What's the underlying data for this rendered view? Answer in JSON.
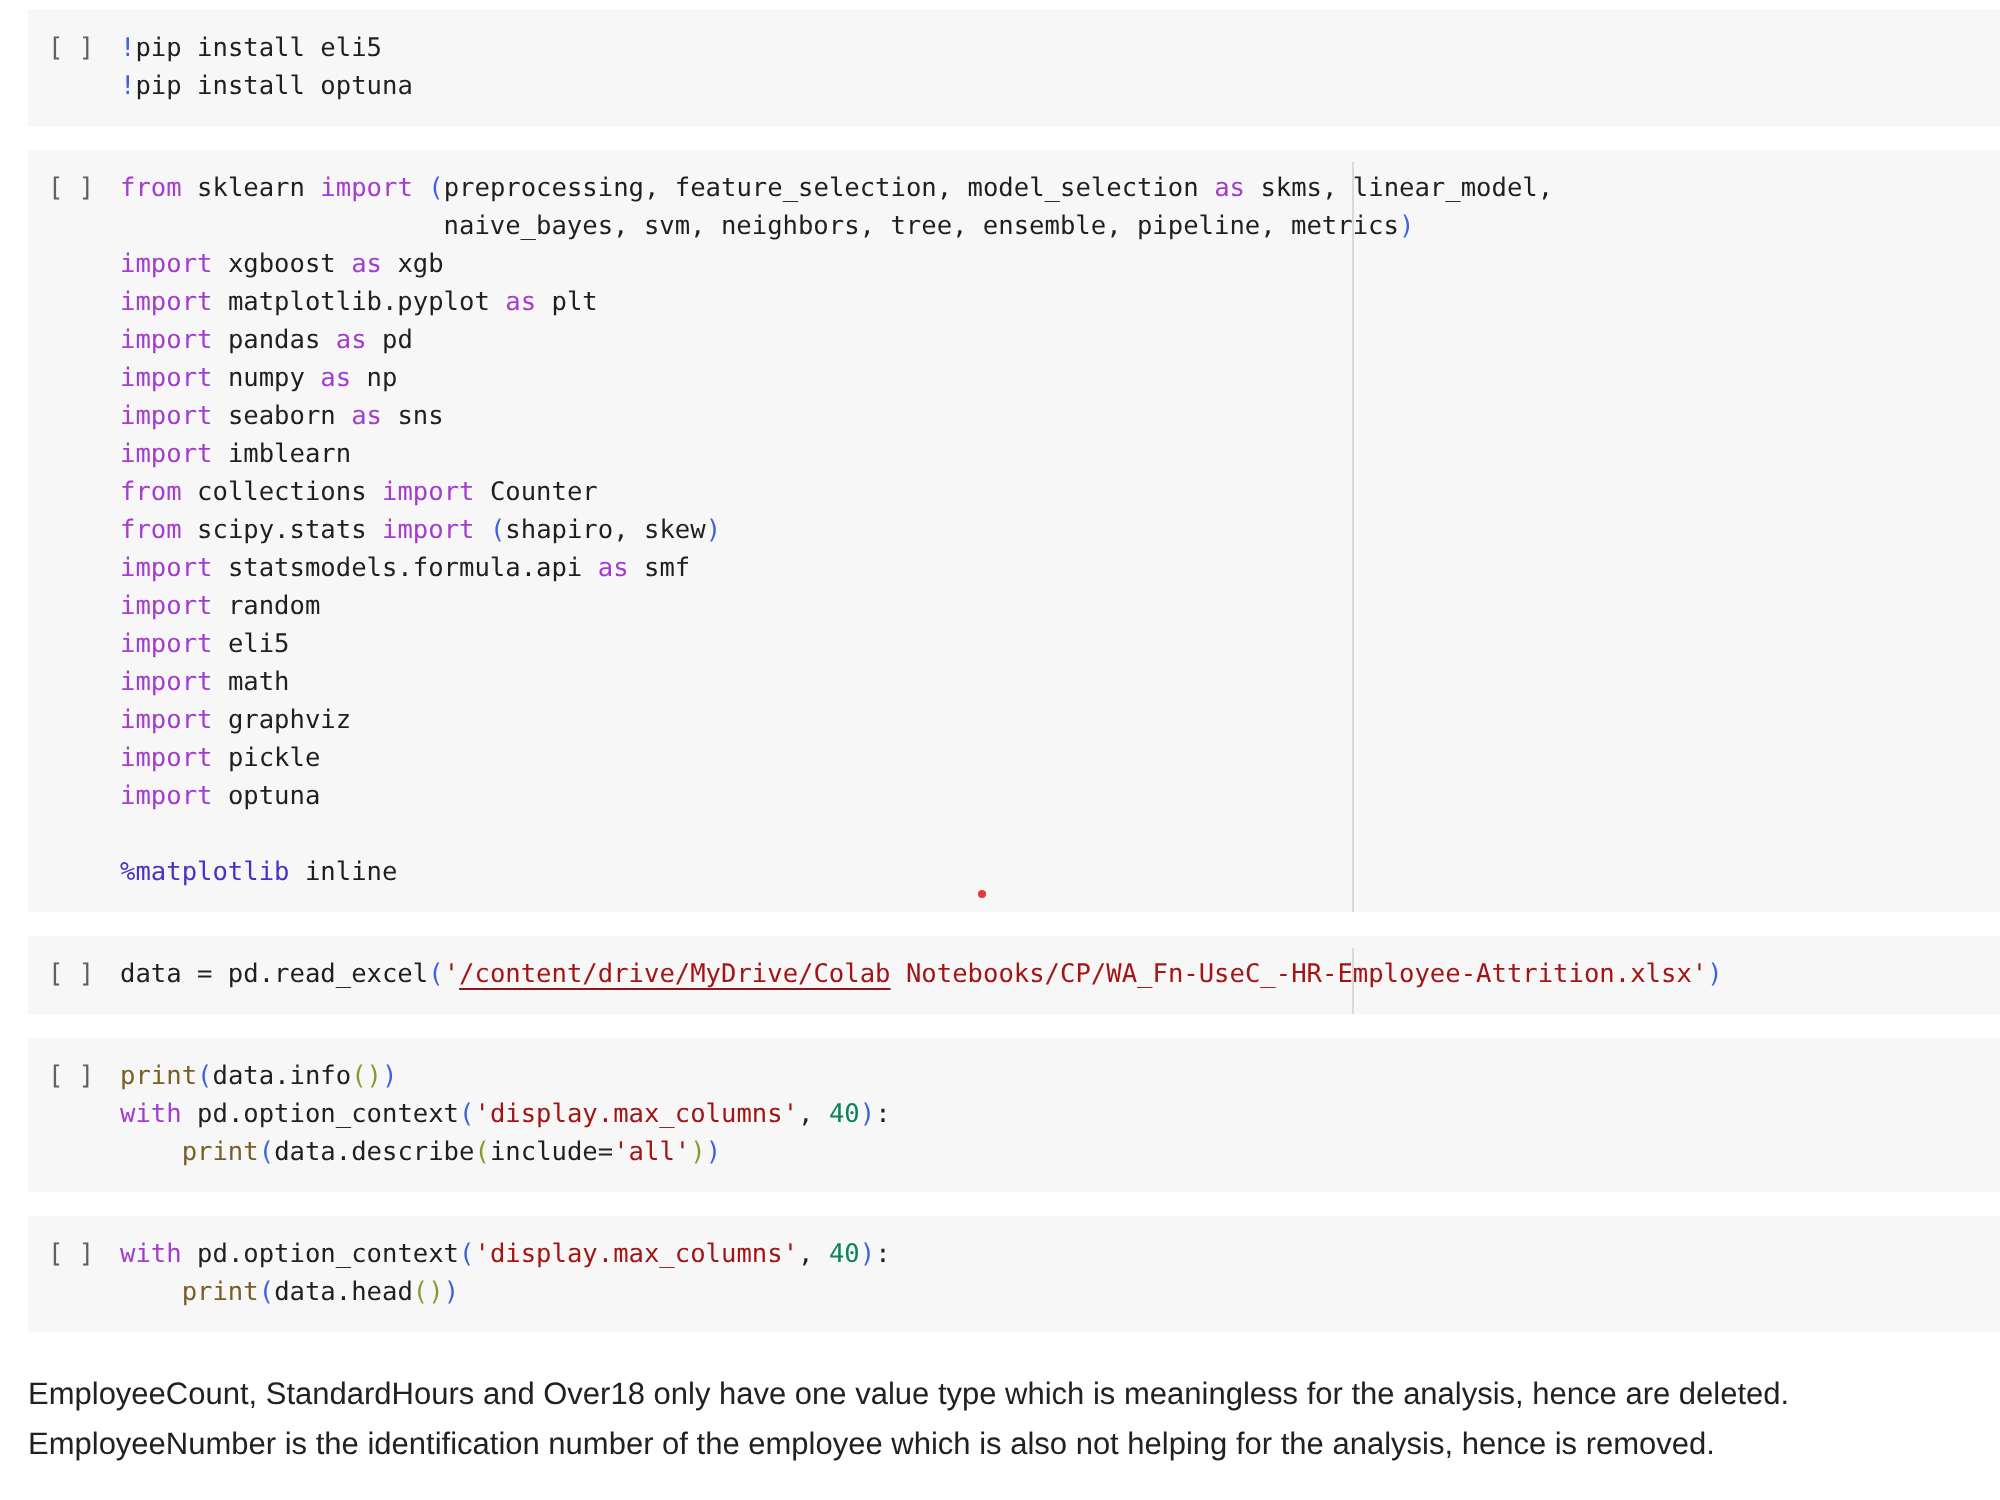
{
  "cells": [
    {
      "prompt": "[ ]",
      "ruler": false,
      "lines": [
        {
          "kind": "code",
          "tokens": [
            {
              "kind": "bang",
              "text": "!"
            },
            {
              "kind": "plain",
              "text": "pip install eli5"
            }
          ]
        },
        {
          "kind": "code",
          "tokens": [
            {
              "kind": "bang",
              "text": "!"
            },
            {
              "kind": "plain",
              "text": "pip install optuna"
            }
          ]
        }
      ]
    },
    {
      "prompt": "[ ]",
      "ruler": true,
      "cursor_dot": true,
      "lines": [
        {
          "kind": "code",
          "tokens": [
            {
              "kind": "keyword",
              "text": "from"
            },
            {
              "kind": "plain",
              "text": " sklearn "
            },
            {
              "kind": "keyword",
              "text": "import "
            },
            {
              "kind": "bracket",
              "text": "("
            },
            {
              "kind": "plain",
              "text": "preprocessing, feature_selection, model_selection "
            },
            {
              "kind": "keyword",
              "text": "as"
            },
            {
              "kind": "plain",
              "text": " skms, linear_model,"
            }
          ]
        },
        {
          "kind": "continuation",
          "tokens": [
            {
              "kind": "plain",
              "text": "naive_bayes, svm, neighbors, tree, ensemble, pipeline, metrics"
            },
            {
              "kind": "bracket",
              "text": ")"
            }
          ]
        },
        {
          "kind": "code",
          "tokens": [
            {
              "kind": "keyword",
              "text": "import"
            },
            {
              "kind": "plain",
              "text": " xgboost "
            },
            {
              "kind": "keyword",
              "text": "as"
            },
            {
              "kind": "plain",
              "text": " xgb"
            }
          ]
        },
        {
          "kind": "code",
          "tokens": [
            {
              "kind": "keyword",
              "text": "import"
            },
            {
              "kind": "plain",
              "text": " matplotlib.pyplot "
            },
            {
              "kind": "keyword",
              "text": "as"
            },
            {
              "kind": "plain",
              "text": " plt"
            }
          ]
        },
        {
          "kind": "code",
          "tokens": [
            {
              "kind": "keyword",
              "text": "import"
            },
            {
              "kind": "plain",
              "text": " pandas "
            },
            {
              "kind": "keyword",
              "text": "as"
            },
            {
              "kind": "plain",
              "text": " pd"
            }
          ]
        },
        {
          "kind": "code",
          "tokens": [
            {
              "kind": "keyword",
              "text": "import"
            },
            {
              "kind": "plain",
              "text": " numpy "
            },
            {
              "kind": "keyword",
              "text": "as"
            },
            {
              "kind": "plain",
              "text": " np"
            }
          ]
        },
        {
          "kind": "code",
          "tokens": [
            {
              "kind": "keyword",
              "text": "import"
            },
            {
              "kind": "plain",
              "text": " seaborn "
            },
            {
              "kind": "keyword",
              "text": "as"
            },
            {
              "kind": "plain",
              "text": " sns"
            }
          ]
        },
        {
          "kind": "code",
          "tokens": [
            {
              "kind": "keyword",
              "text": "import"
            },
            {
              "kind": "plain",
              "text": " imblearn"
            }
          ]
        },
        {
          "kind": "code",
          "tokens": [
            {
              "kind": "keyword",
              "text": "from"
            },
            {
              "kind": "plain",
              "text": " collections "
            },
            {
              "kind": "keyword",
              "text": "import"
            },
            {
              "kind": "plain",
              "text": " Counter"
            }
          ]
        },
        {
          "kind": "code",
          "tokens": [
            {
              "kind": "keyword",
              "text": "from"
            },
            {
              "kind": "plain",
              "text": " scipy.stats "
            },
            {
              "kind": "keyword",
              "text": "import "
            },
            {
              "kind": "bracket",
              "text": "("
            },
            {
              "kind": "plain",
              "text": "shapiro, skew"
            },
            {
              "kind": "bracket",
              "text": ")"
            }
          ]
        },
        {
          "kind": "code",
          "tokens": [
            {
              "kind": "keyword",
              "text": "import"
            },
            {
              "kind": "plain",
              "text": " statsmodels.formula.api "
            },
            {
              "kind": "keyword",
              "text": "as"
            },
            {
              "kind": "plain",
              "text": " smf"
            }
          ]
        },
        {
          "kind": "code",
          "tokens": [
            {
              "kind": "keyword",
              "text": "import"
            },
            {
              "kind": "plain",
              "text": " random"
            }
          ]
        },
        {
          "kind": "code",
          "tokens": [
            {
              "kind": "keyword",
              "text": "import"
            },
            {
              "kind": "plain",
              "text": " eli5"
            }
          ]
        },
        {
          "kind": "code",
          "tokens": [
            {
              "kind": "keyword",
              "text": "import"
            },
            {
              "kind": "plain",
              "text": " math"
            }
          ]
        },
        {
          "kind": "code",
          "tokens": [
            {
              "kind": "keyword",
              "text": "import"
            },
            {
              "kind": "plain",
              "text": " graphviz"
            }
          ]
        },
        {
          "kind": "code",
          "tokens": [
            {
              "kind": "keyword",
              "text": "import"
            },
            {
              "kind": "plain",
              "text": " pickle"
            }
          ]
        },
        {
          "kind": "code",
          "tokens": [
            {
              "kind": "keyword",
              "text": "import"
            },
            {
              "kind": "plain",
              "text": " optuna"
            }
          ]
        },
        {
          "kind": "blank"
        },
        {
          "kind": "code",
          "tokens": [
            {
              "kind": "magic",
              "text": "%matplotlib"
            },
            {
              "kind": "plain",
              "text": " inline"
            }
          ]
        }
      ]
    },
    {
      "prompt": "[ ]",
      "ruler": true,
      "lines": [
        {
          "kind": "code",
          "tokens": [
            {
              "kind": "plain",
              "text": "data = pd.read_excel"
            },
            {
              "kind": "bracket",
              "text": "("
            },
            {
              "kind": "string",
              "text": "'"
            },
            {
              "kind": "link",
              "text": "/content/drive/MyDrive/Colab"
            },
            {
              "kind": "string",
              "text": " Notebooks/CP/WA_Fn-UseC_-HR-Employee-Attrition.xlsx'"
            },
            {
              "kind": "bracket",
              "text": ")"
            }
          ]
        }
      ]
    },
    {
      "prompt": "[ ]",
      "ruler": false,
      "lines": [
        {
          "kind": "code",
          "tokens": [
            {
              "kind": "function",
              "text": "print"
            },
            {
              "kind": "bracket",
              "text": "("
            },
            {
              "kind": "plain",
              "text": "data.info"
            },
            {
              "kind": "bracket2",
              "text": "()"
            },
            {
              "kind": "bracket",
              "text": ")"
            }
          ]
        },
        {
          "kind": "code",
          "tokens": [
            {
              "kind": "keyword",
              "text": "with"
            },
            {
              "kind": "plain",
              "text": " pd.option_context"
            },
            {
              "kind": "bracket",
              "text": "("
            },
            {
              "kind": "string",
              "text": "'display.max_columns'"
            },
            {
              "kind": "plain",
              "text": ", "
            },
            {
              "kind": "number",
              "text": "40"
            },
            {
              "kind": "bracket",
              "text": ")"
            },
            {
              "kind": "plain",
              "text": ":"
            }
          ]
        },
        {
          "kind": "indented",
          "tokens": [
            {
              "kind": "function",
              "text": "print"
            },
            {
              "kind": "bracket",
              "text": "("
            },
            {
              "kind": "plain",
              "text": "data.describe"
            },
            {
              "kind": "bracket2",
              "text": "("
            },
            {
              "kind": "plain",
              "text": "include="
            },
            {
              "kind": "string",
              "text": "'all'"
            },
            {
              "kind": "bracket2",
              "text": ")"
            },
            {
              "kind": "bracket",
              "text": ")"
            }
          ]
        }
      ]
    },
    {
      "prompt": "[ ]",
      "ruler": false,
      "lines": [
        {
          "kind": "code",
          "tokens": [
            {
              "kind": "keyword",
              "text": "with"
            },
            {
              "kind": "plain",
              "text": " pd.option_context"
            },
            {
              "kind": "bracket",
              "text": "("
            },
            {
              "kind": "string",
              "text": "'display.max_columns'"
            },
            {
              "kind": "plain",
              "text": ", "
            },
            {
              "kind": "number",
              "text": "40"
            },
            {
              "kind": "bracket",
              "text": ")"
            },
            {
              "kind": "plain",
              "text": ":"
            }
          ]
        },
        {
          "kind": "indented",
          "tokens": [
            {
              "kind": "function",
              "text": "print"
            },
            {
              "kind": "bracket",
              "text": "("
            },
            {
              "kind": "plain",
              "text": "data.head"
            },
            {
              "kind": "bracket2",
              "text": "()"
            },
            {
              "kind": "bracket",
              "text": ")"
            }
          ]
        }
      ]
    }
  ],
  "text_cell": {
    "paragraphs": [
      "EmployeeCount, StandardHours and Over18 only have one value type which is meaningless for the analysis, hence are deleted.",
      "EmployeeNumber is the identification number of the employee which is also not helping for the analysis, hence is removed."
    ]
  }
}
